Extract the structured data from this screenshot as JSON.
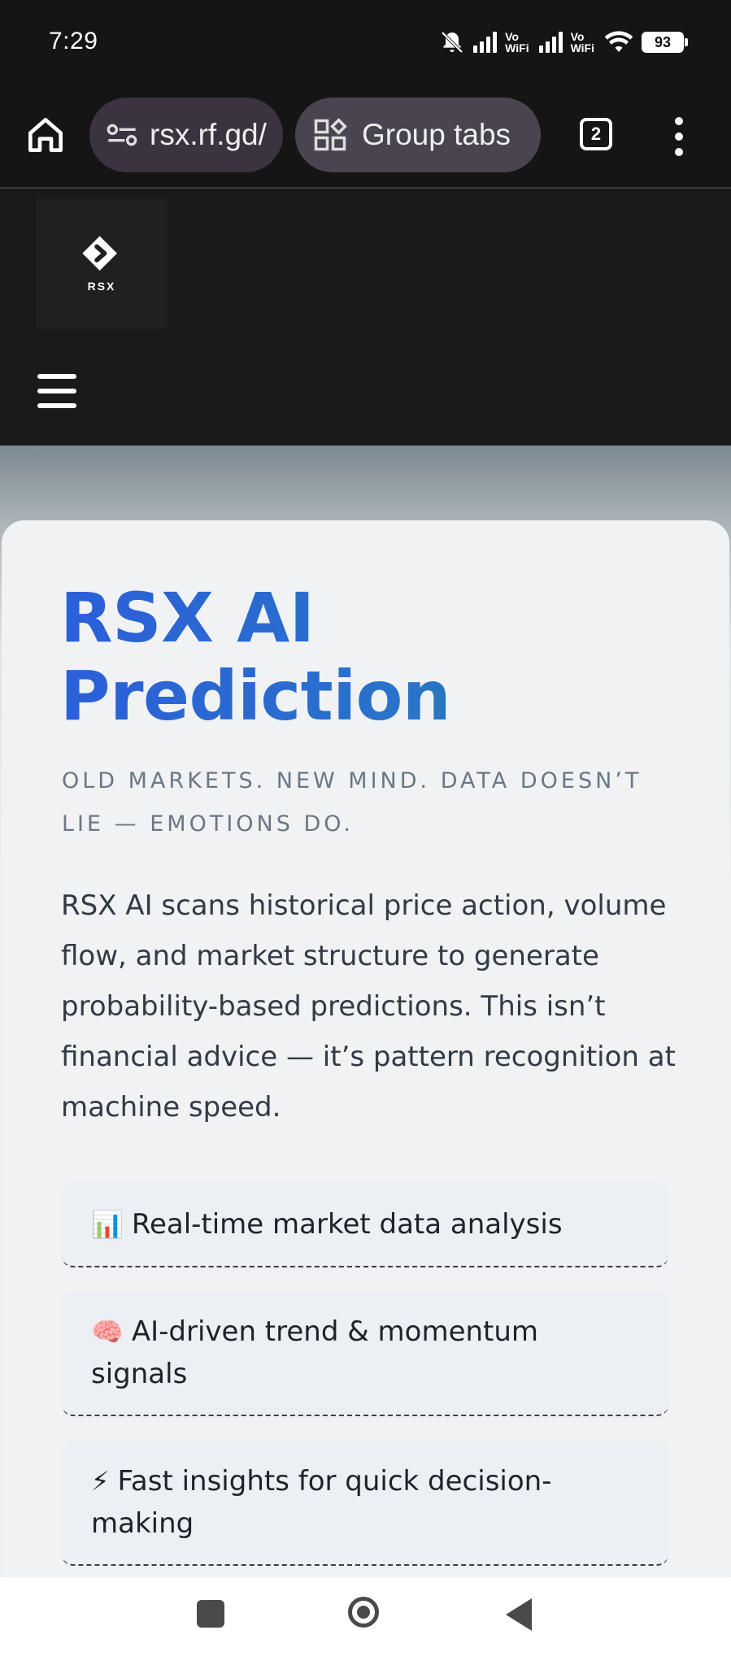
{
  "status_bar": {
    "time": "7:29",
    "vowifi_top": "Vo",
    "vowifi_bottom": "WiFi",
    "battery": "93"
  },
  "browser": {
    "url": "rsx.rf.gd/",
    "group_tabs_label": "Group tabs",
    "tab_count": "2"
  },
  "site": {
    "logo_text": "RSX"
  },
  "hero": {
    "title": "RSX AI Prediction",
    "subtitle": "OLD MARKETS. NEW MIND. DATA DOESN’T LIE — EMOTIONS DO.",
    "description": "RSX AI scans historical price action, volume flow, and market structure to generate probability-based predictions. This isn’t financial advice — it’s pattern recognition at machine speed.",
    "features": [
      {
        "emoji": "📊",
        "text": "Real-time market data analysis"
      },
      {
        "emoji": "🧠",
        "text": "AI-driven trend & momentum signals"
      },
      {
        "emoji": "⚡",
        "text": "Fast insights for quick decision-making"
      }
    ]
  },
  "colors": {
    "title_gradient_start": "#2b5fd9",
    "title_gradient_end": "#15908a",
    "header_bg": "#1a1a1a",
    "card_bg": "#f0f2f3"
  },
  "icons": [
    "home-icon",
    "site-settings-icon",
    "group-tabs-icon",
    "tab-switcher-icon",
    "more-vert-icon",
    "hamburger-menu-icon",
    "nav-recents-icon",
    "nav-home-icon",
    "nav-back-icon",
    "wifi-icon",
    "bell-off-icon",
    "signal-icon"
  ]
}
